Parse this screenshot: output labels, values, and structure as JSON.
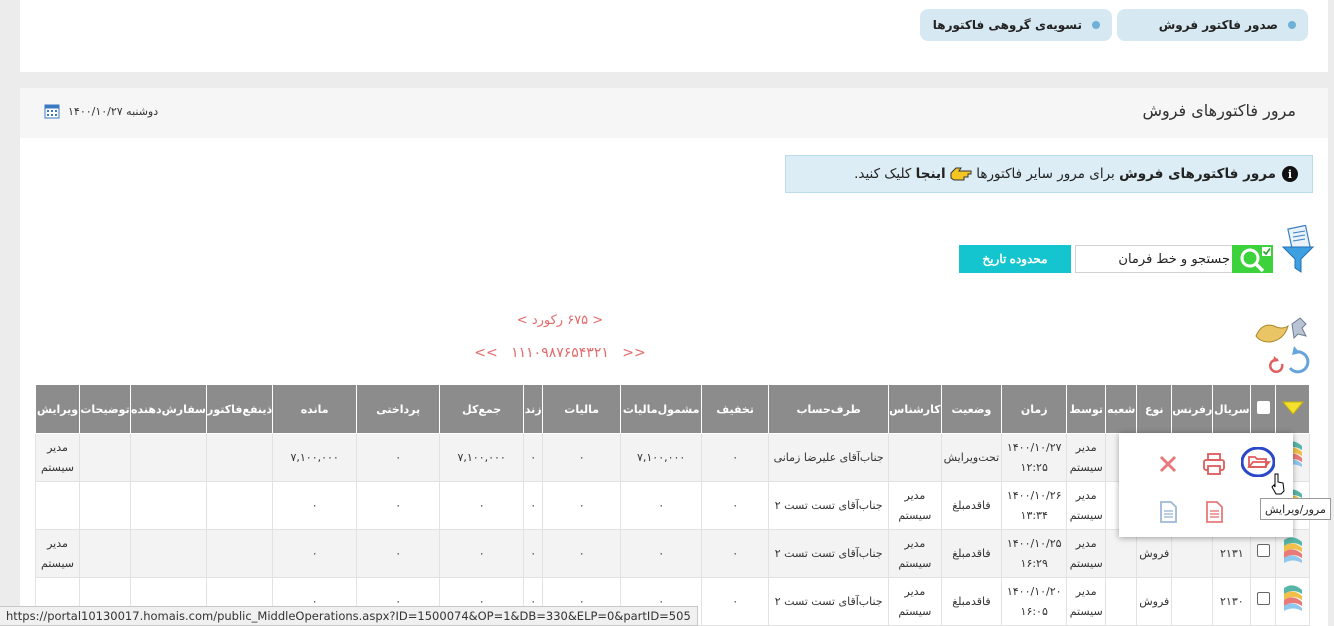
{
  "top_tabs": [
    {
      "label": "صدور فاکتور فروش"
    },
    {
      "label": "تسویه‌ی گروهی فاکتورها"
    }
  ],
  "header": {
    "title": "مرور فاکتورهای فروش",
    "date": "دوشنبه ۱۴۰۰/۱۰/۲۷",
    "calendar_icon": "calendar-icon"
  },
  "info": {
    "bold_part": "مرور فاکتورهای فروش",
    "middle_text": "برای مرور سایر فاکتورها",
    "link_text": "اینجا",
    "end_text": "کلیک کنید."
  },
  "search": {
    "label": "جستجو و خط فرمان",
    "date_range_button": "محدوده تاریخ"
  },
  "paging": {
    "record_count": "<   ۶۷۵ رکورد   >",
    "first": "<<",
    "pages": "۱۱۱۰۹۸۷۶۵۴۳۲۱",
    "last": ">>"
  },
  "table": {
    "columns": [
      "",
      "",
      "سریال",
      "رفرنس",
      "نوع",
      "شعبه",
      "توسط",
      "زمان",
      "وضعیت",
      "کارشناس",
      "طرف‌حساب",
      "تخفیف",
      "مشمول‌مالیات",
      "مالیات",
      "زند",
      "جمع‌کل",
      "پرداختی",
      "مانده",
      "ذینفع‌فاکتور",
      "سفارش‌دهنده",
      "توضیحات",
      "ویرایش"
    ],
    "rows": [
      {
        "serial": "",
        "ref": "",
        "type": "",
        "branch": "",
        "by": "مدیر سیستم",
        "time": "۱۴۰۰/۱۰/۲۷ ۱۲:۲۵",
        "status": "تحت‌ویرایش",
        "expert": "",
        "party": "جناب‌آقای علیرضا زمانی",
        "discount": "۰",
        "taxable": "۷,۱۰۰,۰۰۰",
        "tax": "۰",
        "znd": "۰",
        "total": "۷,۱۰۰,۰۰۰",
        "paid": "۰",
        "remain": "۷,۱۰۰,۰۰۰",
        "beneficiary": "",
        "orderer": "",
        "desc": "",
        "editor": "مدیر سیستم"
      },
      {
        "serial": "",
        "ref": "",
        "type": "",
        "branch": "",
        "by": "مدیر سیستم",
        "time": "۱۴۰۰/۱۰/۲۶ ۱۳:۳۴",
        "status": "فاقدمبلغ",
        "expert": "مدیر سیستم",
        "party": "جناب‌آقای تست تست ۲",
        "discount": "۰",
        "taxable": "۰",
        "tax": "۰",
        "znd": "۰",
        "total": "۰",
        "paid": "۰",
        "remain": "۰",
        "beneficiary": "",
        "orderer": "",
        "desc": "",
        "editor": ""
      },
      {
        "serial": "۲۱۳۱",
        "ref": "",
        "type": "فروش",
        "branch": "",
        "by": "مدیر سیستم",
        "time": "۱۴۰۰/۱۰/۲۵ ۱۶:۲۹",
        "status": "فاقدمبلغ",
        "expert": "مدیر سیستم",
        "party": "جناب‌آقای تست تست ۲",
        "discount": "۰",
        "taxable": "۰",
        "tax": "۰",
        "znd": "۰",
        "total": "۰",
        "paid": "۰",
        "remain": "۰",
        "beneficiary": "",
        "orderer": "",
        "desc": "",
        "editor": "مدیر سیستم"
      },
      {
        "serial": "۲۱۳۰",
        "ref": "",
        "type": "فروش",
        "branch": "",
        "by": "مدیر سیستم",
        "time": "۱۴۰۰/۱۰/۲۰ ۱۶:۰۵",
        "status": "فاقدمبلغ",
        "expert": "مدیر سیستم",
        "party": "جناب‌آقای تست تست ۲",
        "discount": "۰",
        "taxable": "۰",
        "tax": "۰",
        "znd": "۰",
        "total": "۰",
        "paid": "۰",
        "remain": "۰",
        "beneficiary": "",
        "orderer": "",
        "desc": "",
        "editor": ""
      }
    ]
  },
  "popup": {
    "tooltip": "مرور/ویرایش",
    "icons": [
      "folder-open-icon",
      "print-icon",
      "delete-icon",
      "document-icon",
      "document-copy-icon"
    ]
  },
  "status_bar": {
    "url": "https://portal10130017.homais.com/public_MiddleOperations.aspx?ID=1500074&OP=1&DB=330&ELP=0&partID=505"
  },
  "colors": {
    "accent_blue": "#2a48c8",
    "action_red": "#e05a5a",
    "search_green": "#3bd23b",
    "date_btn_cyan": "#14c5cf",
    "pager_red": "#e46a6a",
    "header_gray": "#8c8c8c"
  }
}
